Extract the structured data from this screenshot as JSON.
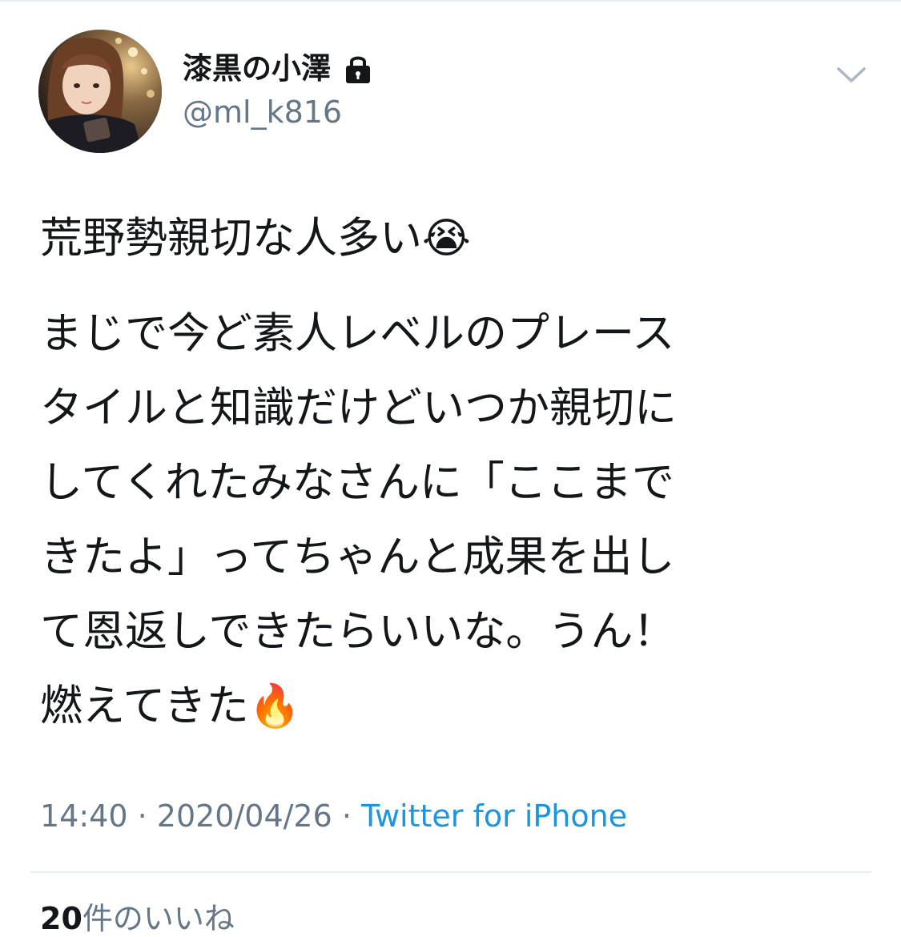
{
  "tweet": {
    "author": {
      "display_name": "漆黒の小澤",
      "handle": "@ml_k816",
      "avatar_icon": "profile-photo",
      "locked_icon": "lock-icon"
    },
    "menu_icon": "chevron-down-icon",
    "text": {
      "line1": "荒野勢親切な人多い",
      "line1_emoji": "😭",
      "para2": [
        "まじで今ど素人レベルのプレース",
        "タイルと知識だけどいつか親切に",
        "してくれたみなさんに「ここまで",
        "きたよ」ってちゃんと成果を出し",
        "て恩返しできたらいいな。うん！"
      ],
      "last_line": "燃えてきた",
      "last_line_emoji": "🔥"
    },
    "meta": {
      "time": "14:40",
      "separator": " · ",
      "date": "2020/04/26",
      "source": "Twitter for iPhone"
    },
    "likes": {
      "count": "20",
      "label": "件のいいね"
    }
  },
  "colors": {
    "text": "#14171a",
    "secondary": "#657786",
    "link": "#1b95e0",
    "divider": "#e6ecf0"
  }
}
